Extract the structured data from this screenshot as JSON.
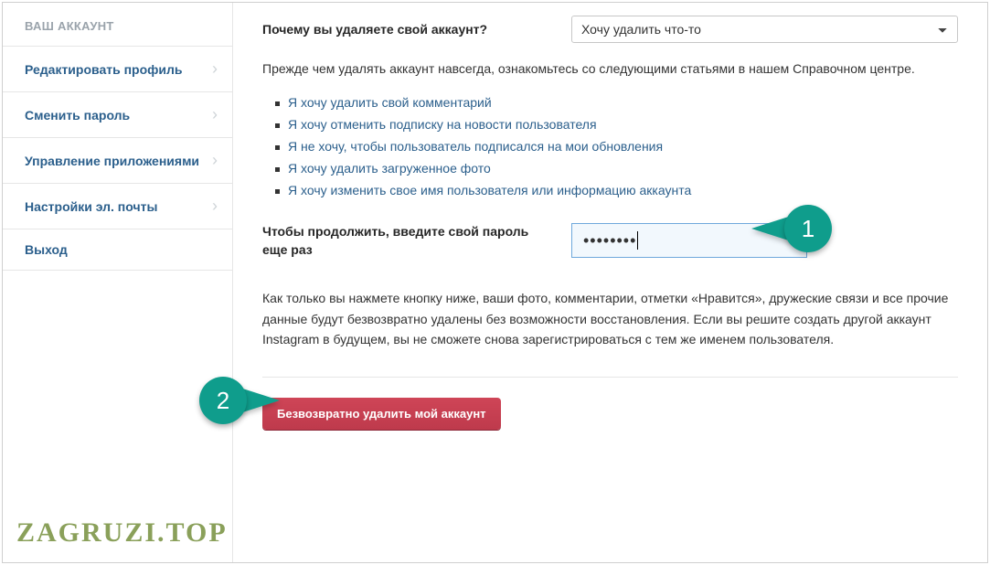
{
  "sidebar": {
    "header": "ВАШ АККАУНТ",
    "items": [
      {
        "label": "Редактировать профиль",
        "has_chevron": true
      },
      {
        "label": "Сменить пароль",
        "has_chevron": true
      },
      {
        "label": "Управление приложениями",
        "has_chevron": true
      },
      {
        "label": "Настройки эл. почты",
        "has_chevron": true
      },
      {
        "label": "Выход",
        "has_chevron": false
      }
    ]
  },
  "main": {
    "question_label": "Почему вы удаляете свой аккаунт?",
    "reason_selected": "Хочу удалить что-то",
    "intro_text": "Прежде чем удалять аккаунт навсегда, ознакомьтесь со следующими статьями в нашем Справочном центре.",
    "help_links": [
      "Я хочу удалить свой комментарий",
      "Я хочу отменить подписку на новости пользователя",
      "Я не хочу, чтобы пользователь подписался на мои обновления",
      "Я хочу удалить загруженное фото",
      "Я хочу изменить свое имя пользователя или информацию аккаунта"
    ],
    "password_label": "Чтобы продолжить, введите свой пароль еще раз",
    "password_value": "••••••••",
    "warning_text": "Как только вы нажмете кнопку ниже, ваши фото, комментарии, отметки «Нравится», дружеские связи и все прочие данные будут безвозвратно удалены без возможности восстановления. Если вы решите создать другой аккаунт Instagram в будущем, вы не сможете снова зарегистрироваться с тем же именем пользователя.",
    "delete_button": "Безвозвратно удалить мой аккаунт"
  },
  "callouts": {
    "one": "1",
    "two": "2"
  },
  "watermark": "ZAGRUZI.TOP"
}
